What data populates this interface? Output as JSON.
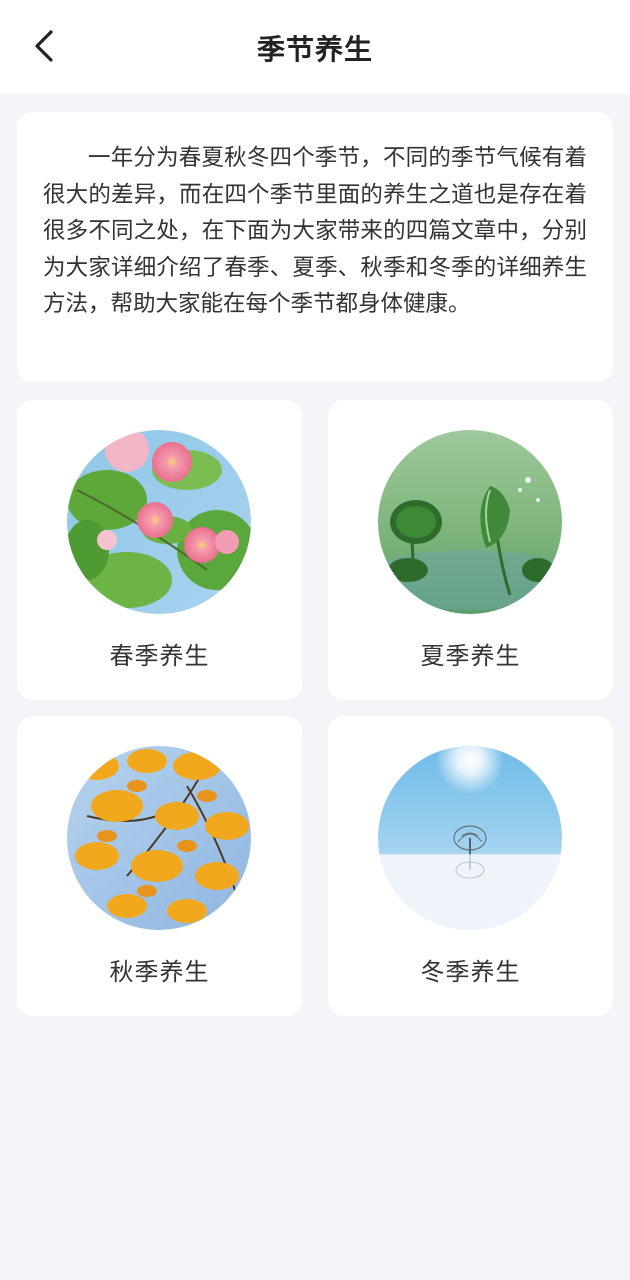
{
  "header": {
    "title": "季节养生",
    "back_icon": "chevron-left-icon"
  },
  "intro": {
    "text": "一年分为春夏秋冬四个季节，不同的季节气候有着很大的差异，而在四个季节里面的养生之道也是存在着很多不同之处，在下面为大家带来的四篇文章中，分别为大家详细介绍了春季、夏季、秋季和冬季的详细养生方法，帮助大家能在每个季节都身体健康。"
  },
  "seasons": [
    {
      "label": "春季养生",
      "image": "spring-blossom-image"
    },
    {
      "label": "夏季养生",
      "image": "summer-lotus-leaf-image"
    },
    {
      "label": "秋季养生",
      "image": "autumn-leaves-image"
    },
    {
      "label": "冬季养生",
      "image": "winter-snow-tree-image"
    }
  ],
  "colors": {
    "background": "#f4f5f9",
    "card": "#ffffff",
    "text": "#333333"
  }
}
